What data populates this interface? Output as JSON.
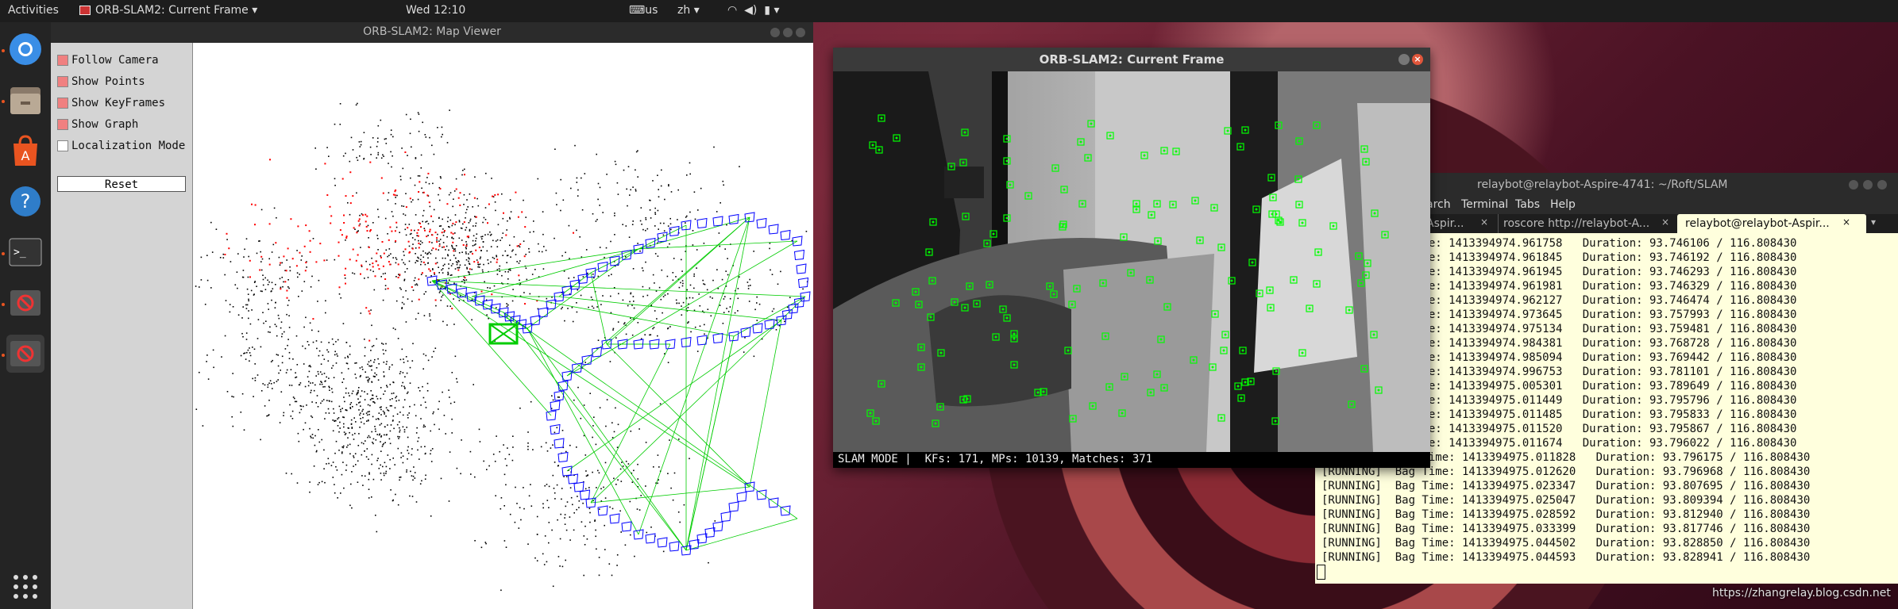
{
  "topbar": {
    "activities": "Activities",
    "app_menu": "ORB-SLAM2: Current Frame",
    "clock": "Wed 12:10",
    "input_method": "us",
    "input_lang": "zh"
  },
  "dock": {
    "items": [
      {
        "name": "chromium-icon"
      },
      {
        "name": "files-icon"
      },
      {
        "name": "software-center-icon"
      },
      {
        "name": "help-icon"
      },
      {
        "name": "terminal-icon"
      },
      {
        "name": "slam-app-icon"
      },
      {
        "name": "slam-app-icon-2"
      }
    ],
    "show_apps": "show-applications-icon"
  },
  "map_viewer": {
    "title": "ORB-SLAM2: Map Viewer",
    "options": [
      {
        "label": "Follow Camera",
        "checked": true
      },
      {
        "label": "Show Points",
        "checked": true
      },
      {
        "label": "Show KeyFrames",
        "checked": true
      },
      {
        "label": "Show Graph",
        "checked": true
      },
      {
        "label": "Localization Mode",
        "checked": false
      }
    ],
    "reset_label": "Reset",
    "colors": {
      "map_points": "#000000",
      "local_points": "#ff0000",
      "keyframes": "#0000ff",
      "graph": "#00cc00",
      "current_camera": "#00cc00"
    }
  },
  "current_frame": {
    "title": "ORB-SLAM2: Current Frame",
    "status": "SLAM MODE |  KFs: 171, MPs: 10139, Matches: 371",
    "feature_color": "#00ff00"
  },
  "terminal": {
    "title": "relaybot@relaybot-Aspire-4741: ~/Roft/SLAM",
    "menu": [
      "arch",
      "Terminal",
      "Tabs",
      "Help"
    ],
    "tabs": [
      "Aspir...",
      "roscore http://relaybot-A...",
      "relaybot@relaybot-Aspir..."
    ],
    "lines": [
      "         Bag Time: 1413394974.961758   Duration: 93.746106 / 116.808430",
      "         Bag Time: 1413394974.961845   Duration: 93.746192 / 116.808430",
      "         Bag Time: 1413394974.961945   Duration: 93.746293 / 116.808430",
      "         Bag Time: 1413394974.961981   Duration: 93.746329 / 116.808430",
      "         Bag Time: 1413394974.962127   Duration: 93.746474 / 116.808430",
      "         Bag Time: 1413394974.973645   Duration: 93.757993 / 116.808430",
      "         Bag Time: 1413394974.975134   Duration: 93.759481 / 116.808430",
      "         Bag Time: 1413394974.984381   Duration: 93.768728 / 116.808430",
      "         Bag Time: 1413394974.985094   Duration: 93.769442 / 116.808430",
      "         Bag Time: 1413394974.996753   Duration: 93.781101 / 116.808430",
      "         Bag Time: 1413394975.005301   Duration: 93.789649 / 116.808430",
      "         Bag Time: 1413394975.011449   Duration: 93.795796 / 116.808430",
      "         Bag Time: 1413394975.011485   Duration: 93.795833 / 116.808430",
      "         Bag Time: 1413394975.011520   Duration: 93.795867 / 116.808430",
      "         Bag Time: 1413394975.011674   Duration: 93.796022 / 116.808430",
      "[RUNNING]  Bag Time: 1413394975.011828   Duration: 93.796175 / 116.808430",
      "[RUNNING]  Bag Time: 1413394975.012620   Duration: 93.796968 / 116.808430",
      "[RUNNING]  Bag Time: 1413394975.023347   Duration: 93.807695 / 116.808430",
      "[RUNNING]  Bag Time: 1413394975.025047   Duration: 93.809394 / 116.808430",
      "[RUNNING]  Bag Time: 1413394975.028592   Duration: 93.812940 / 116.808430",
      "[RUNNING]  Bag Time: 1413394975.033399   Duration: 93.817746 / 116.808430",
      "[RUNNING]  Bag Time: 1413394975.044502   Duration: 93.828850 / 116.808430",
      "[RUNNING]  Bag Time: 1413394975.044593   Duration: 93.828941 / 116.808430"
    ]
  },
  "watermark": "https://zhangrelay.blog.csdn.net"
}
